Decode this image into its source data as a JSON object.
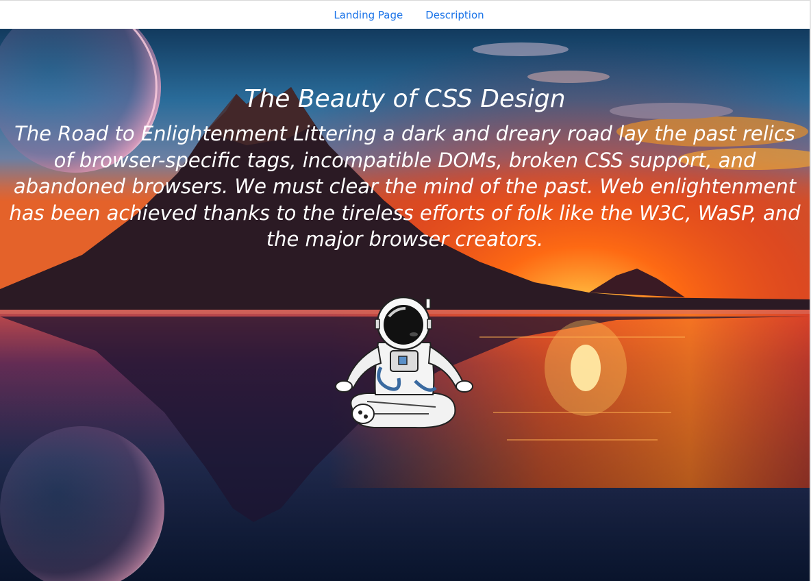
{
  "nav": {
    "links": [
      {
        "label": "Landing Page"
      },
      {
        "label": "Description"
      }
    ]
  },
  "hero": {
    "title": "The Beauty of CSS Design",
    "text": "The Road to Enlightenment Littering a dark and dreary road lay the past relics of browser-specific tags, incompatible DOMs, broken CSS support, and abandoned browsers. We must clear the mind of the past. Web enlightenment has been achieved thanks to the tireless efforts of folk like the W3C, WaSP, and the major browser creators."
  },
  "colors": {
    "nav_link": "#1a73e8",
    "sky_top": "#14314f",
    "sunset": "#ff5a10",
    "hero_text": "#ffffff"
  }
}
